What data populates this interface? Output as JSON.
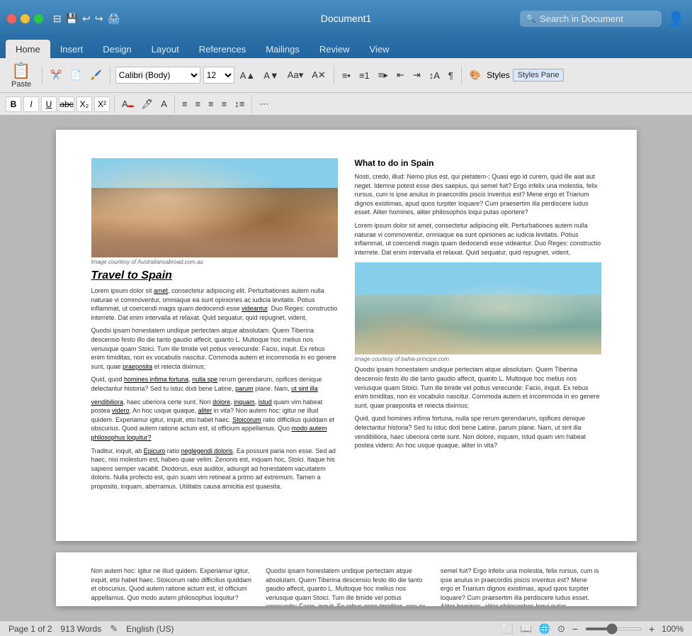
{
  "titleBar": {
    "docTitle": "Document1",
    "searchPlaceholder": "Search in Document",
    "windowControls": [
      "close",
      "minimize",
      "maximize"
    ],
    "icons": [
      "sidebar-toggle",
      "save",
      "undo",
      "redo-arrow",
      "print"
    ]
  },
  "ribbonTabs": {
    "tabs": [
      "Home",
      "Insert",
      "Design",
      "Layout",
      "References",
      "Mailings",
      "Review",
      "View"
    ],
    "activeTab": "Home"
  },
  "toolbar": {
    "pasteLabel": "Paste",
    "fontFamily": "Calibri (Body)",
    "fontSize": "12",
    "formatButtons": [
      "B",
      "I",
      "U",
      "ab̲c",
      "X₂",
      "X²"
    ],
    "stylesLabel": "Styles",
    "stylesPaneLabel": "Styles Pane"
  },
  "document": {
    "page1": {
      "left": {
        "imageCaption": "Image courtesy of Australiansabroad.com.au",
        "articleTitle": "Travel to Spain",
        "bodyText": "Lorem ipsum dolor sit amet, consectetur adipiscing elit. Perturbationes autem nulla naturae vi commoventur, omniaque ea sunt opiniones ac iudicia levitatis. Potius inflammat, ut coercendi magis quam dedocendi esse videantur. Duo Reges: constructio interrete. Dat enim intervalla et relaxat. Quid sequatur, quid repugnet, vident,\n\nQuodsi ipsam honestatem undique pertectam atque absolutam. Quem Tiberina descensio festo illo die tanto gaudio affecit, quanto L. Multoque hoc melius nos veriusque quam Stoici. Tum ille timide vel potius verecunde: Facio, inquit. Ex rebus enim timiditas, non ex vocabulis nascitur. Commoda autem et incommoda in eo genere sunt, quae praeposita et reiecta diximus;\n\nQuid, quod homines infima fortuna, nulla spe rerum gerendarum, opifices denique delectantur historia? Sed tu istuc dixti bene Latine, parum plane. Nam, ut sint illa",
        "continuesText": "vendibiliora, haec uberiora certe sunt. Non dolore, inquam, istud quam vim habeat postea videro; An hoc usque quaque, aliter in vita? Non autem hoc: igitur ne illud quidem. Experiamur igitur, inquit, etsi habet haec. Stoicorum ratio difficilius quiddam et obscurius. Quod autem ratione actum est, id officium appellamus. Quo modo autem philosophus loquitur?\n\nTraditur, inquit, ab Epicuro ratio neglegendi doloris. Ea possunt paria non esse. Sed ad haec, nisi molestum est, habeo quae velim. Zenonis est, inquam hoc, Stoici. Itaque his sapiens semper vacabit. Diodorus, eius auditor, adiungit ad honestatem vacuitatem doloris. Nulla profecto est, quin suam vim retineat a primo ad extremum. Tamen a proposito, inquam, aberramus. Utilitatis causa amicitia est quaesita."
      },
      "right": {
        "sectionTitle": "What to do in Spain",
        "bodyText1": "Nosti, credo, illud: Nemo plus est, qui pietatem-; Quasi ego id curem, quid ille aiat aut neget. Idemne potest esse dies saepius, qui semel fuit? Ergo infelix una molestia, felix rursus, cum is ipse anulus in praecordiis piscis inventus est? Mene ergo et Triarium dignos existimas, apud quos turpiter loquare? Cum praesertim illa perdiscere ludus esset. Aliter homines, aliter philosophos loqui putas oportere?\n\nLorem ipsum dolor sit amet, consectetur adipiscing elit. Perturbationes autem nulla naturae vi commoventur, omniaque ea sunt opiniones ac iudicia levitatis. Potius inflammat, ut coercendi magis quam dedocendi esse videantur. Duo Reges: constructio interrete. Dat enim intervalla et relaxat. Quid sequatur, quid repugnet, vident,\n\nQuodsi ipsam honestatem undique pertectam atque absolutam. Quem Tiberina descensio festo illo die tanto gaudio affecit, quanto L. Multoque hoc melius nos veriusque quam Stoici. Tum ille timide vel potius verecunde: Facio, inquit. Ex rebus enim timiditas, non ex vocabulis nascitur. Commoda autem et incommoda in eo genere sunt, quae praeposita et reiecta diximus;",
        "midImageCaption": "Image courtesy of bahia-principe.com",
        "bodyText2": "Quid, quod homines infima fortuna, nulla spe rerum gerendarum, opifices denique delectantur historia? Sed tu istuc dixti bene Latine, parum plane. Nam, ut sint illa vendibiliora, haec uberiora certe sunt. Non dolore, inquam, istud quam vim habeat postea videro; An hoc usque quaque, aliter in vita?"
      }
    },
    "page2": {
      "col1": "Non autem hoc: igitur ne illud quidem. Experiamur igitur, inquit, etsi habet haec. Stoicorum ratio difficilius quiddam et obscurius. Quod autem ratione actum est, id officium appellamus. Quo modo autem philosophus loquitur?",
      "col2": "Quodsi ipsam honestatem undique pertectam atque absolutam. Quem Tiberina descensio festo illo die tanto gaudio affecit, quanto L. Multoque hoc melius nos veriusque quam Stoici. Tum ille timide vel potius verecunde: Facio, inquit. Ex rebus enim timiditas, non ex",
      "col3": "semel fuit? Ergo infelix una molestia, felix rursus, cum is ipse anulus in praecordiis piscis inventus est? Mene ergo et Triarium dignos existimas, apud quos turpiter loquare? Cum praesertim illa perdiscere ludus esset. Aliter homines, aliter philosophos loqui putas"
    }
  },
  "statusBar": {
    "pageInfo": "Page 1 of 2",
    "wordCount": "913 Words",
    "language": "English (US)",
    "zoom": "100%"
  },
  "colors": {
    "ribbonBlue": "#2b6fa8",
    "ribbonDark": "#1d5a8a",
    "tabActive": "#e8e8e8"
  }
}
